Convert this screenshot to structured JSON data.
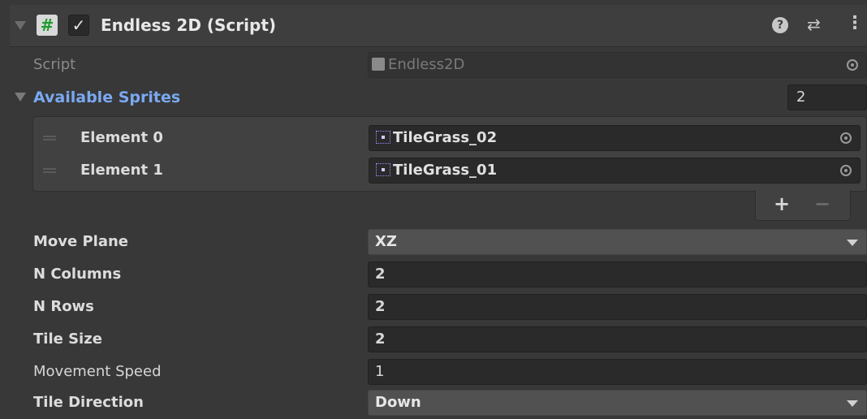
{
  "component": {
    "title": "Endless 2D (Script)",
    "script_glyph": "#",
    "enabled_glyph": "✓",
    "help_glyph": "?",
    "preset_glyph": "⇄",
    "menu_glyph": "⋮"
  },
  "script_row": {
    "label": "Script",
    "value": "Endless2D"
  },
  "available_sprites": {
    "label": "Available Sprites",
    "size": "2",
    "elements": [
      {
        "label": "Element 0",
        "value": "TileGrass_02"
      },
      {
        "label": "Element 1",
        "value": "TileGrass_01"
      }
    ],
    "add_glyph": "+",
    "remove_glyph": "−"
  },
  "fields": {
    "move_plane": {
      "label": "Move Plane",
      "value": "XZ"
    },
    "n_columns": {
      "label": "N Columns",
      "value": "2"
    },
    "n_rows": {
      "label": "N Rows",
      "value": "2"
    },
    "tile_size": {
      "label": "Tile Size",
      "value": "2"
    },
    "movement_speed": {
      "label": "Movement Speed",
      "value": "1"
    },
    "tile_direction": {
      "label": "Tile Direction",
      "value": "Down"
    }
  },
  "colors": {
    "background": "#383838",
    "header": "#3e3e3e",
    "field": "#2a2a2a",
    "accent_blue": "#7aa9f2",
    "script_icon_green": "#1f9b2e"
  }
}
